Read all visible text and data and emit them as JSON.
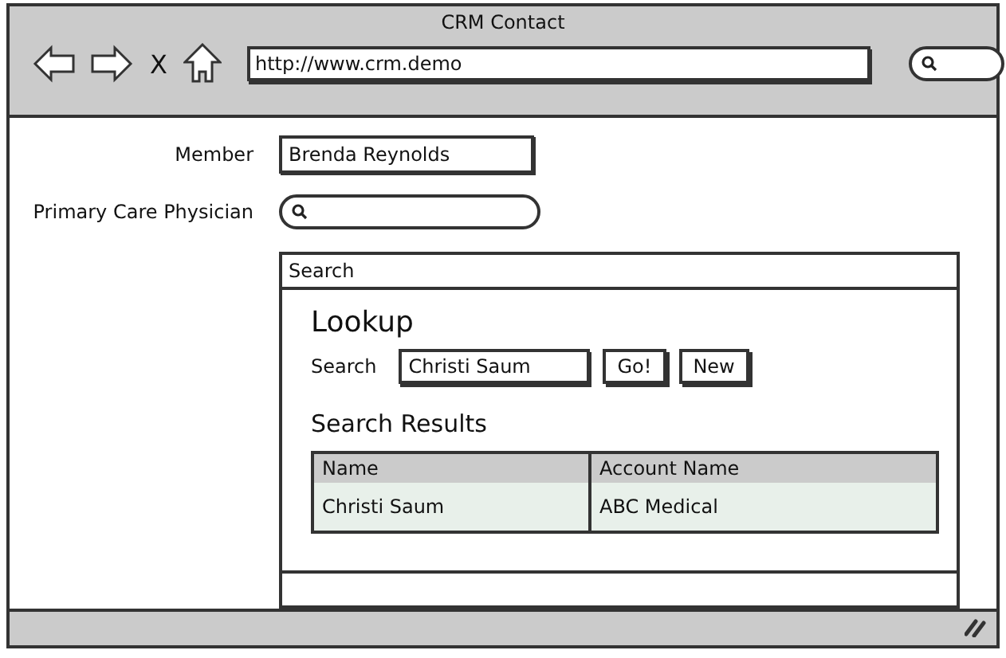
{
  "window": {
    "title": "CRM Contact"
  },
  "browser": {
    "url": "http://www.crm.demo",
    "close_glyph": "X"
  },
  "form": {
    "member_label": "Member",
    "member_value": "Brenda Reynolds",
    "physician_label": "Primary Care Physician"
  },
  "panel": {
    "header": "Search",
    "heading": "Lookup",
    "search_label": "Search",
    "search_value": "Christi Saum",
    "buttons": [
      "Go!",
      "New"
    ],
    "results_heading": "Search Results",
    "table": {
      "columns": [
        "Name",
        "Account Name"
      ],
      "rows": [
        {
          "cells": [
            "Christi Saum",
            "ABC Medical"
          ],
          "selected": true
        }
      ]
    }
  }
}
